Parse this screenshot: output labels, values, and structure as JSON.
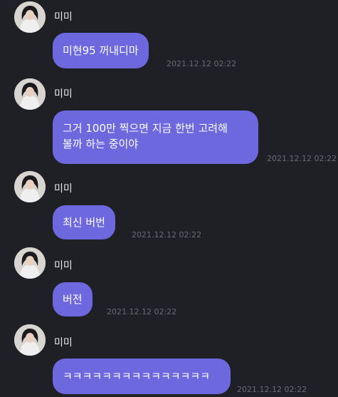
{
  "chat": {
    "messages": [
      {
        "sender": "미미",
        "avatar_icon": "profile-photo-icon",
        "lines": [
          "미현95 꺼내디마"
        ],
        "time": "2021.12.12 02:22"
      },
      {
        "sender": "미미",
        "avatar_icon": "profile-photo-icon",
        "lines": [
          "그거 100만 찍으면 지금 한번 고려해",
          "볼까 하는 중이야"
        ],
        "time": "2021.12.12 02:22"
      },
      {
        "sender": "미미",
        "avatar_icon": "profile-photo-icon",
        "lines": [
          "최신 버번"
        ],
        "time": "2021.12.12 02:22"
      },
      {
        "sender": "미미",
        "avatar_icon": "profile-photo-icon",
        "lines": [
          "버전"
        ],
        "time": "2021.12.12 02:22"
      },
      {
        "sender": "미미",
        "avatar_icon": "profile-photo-icon",
        "lines": [
          "ㅋㅋㅋㅋㅋㅋㅋㅋㅋㅋㅋㅋㅋㅋㅋ"
        ],
        "time": "2021.12.12 02:22"
      }
    ]
  },
  "colors": {
    "background": "#1f1f26",
    "bubble": "#6e68de",
    "timestamp": "#6a6a78"
  }
}
